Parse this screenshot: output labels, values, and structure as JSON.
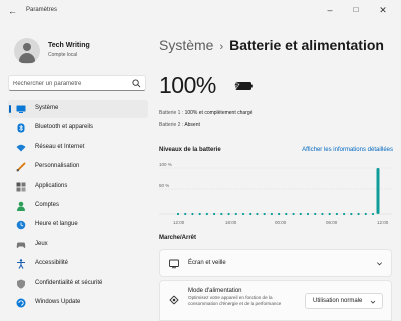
{
  "window": {
    "title": "Paramètres",
    "back_glyph": "←",
    "minimize_glyph": "–",
    "maximize_glyph": "□",
    "close_glyph": "✕"
  },
  "profile": {
    "name": "Tech Writing",
    "account_type": "Compte local"
  },
  "search": {
    "placeholder": "Rechercher un paramètre"
  },
  "sidebar": {
    "items": [
      {
        "label": "Système",
        "icon": "monitor-icon",
        "active": true
      },
      {
        "label": "Bluetooth et appareils",
        "icon": "bluetooth-icon"
      },
      {
        "label": "Réseau et Internet",
        "icon": "wifi-icon"
      },
      {
        "label": "Personnalisation",
        "icon": "brush-icon"
      },
      {
        "label": "Applications",
        "icon": "apps-icon"
      },
      {
        "label": "Comptes",
        "icon": "person-icon"
      },
      {
        "label": "Heure et langue",
        "icon": "globe-clock-icon"
      },
      {
        "label": "Jeux",
        "icon": "gamepad-icon"
      },
      {
        "label": "Accessibilité",
        "icon": "accessibility-icon"
      },
      {
        "label": "Confidentialité et sécurité",
        "icon": "shield-icon"
      },
      {
        "label": "Windows Update",
        "icon": "update-icon"
      }
    ]
  },
  "breadcrumb": {
    "parent": "Système",
    "separator": "›",
    "current": "Batterie et alimentation"
  },
  "battery": {
    "percent_text": "100%",
    "lines": [
      {
        "label": "Batterie 1 :",
        "value": "100% et complètement chargé"
      },
      {
        "label": "Batterie 2 :",
        "value": "Absent"
      }
    ]
  },
  "battery_level": {
    "title": "Niveaux de la batterie",
    "details_link": "Afficher les informations détaillées"
  },
  "chart_data": {
    "type": "line",
    "y_ticks": [
      "100 %",
      "50 %"
    ],
    "x_ticks": [
      "12:00",
      "18:00",
      "00:00",
      "06:00",
      "12:00"
    ],
    "ylim": [
      0,
      100
    ],
    "dots_count": 28,
    "final_bar_value": 100,
    "accent": "#0f9d9a"
  },
  "power": {
    "section_title": "Marche/Arrêt",
    "screen_sleep_label": "Écran et veille",
    "power_mode_title": "Mode d'alimentation",
    "power_mode_desc": "Optimisez votre appareil en fonction de la consommation d'énergie et de la performance",
    "power_mode_value": "Utilisation normale"
  },
  "colors": {
    "accent": "#0067c0",
    "chart_teal": "#0f9d9a"
  }
}
